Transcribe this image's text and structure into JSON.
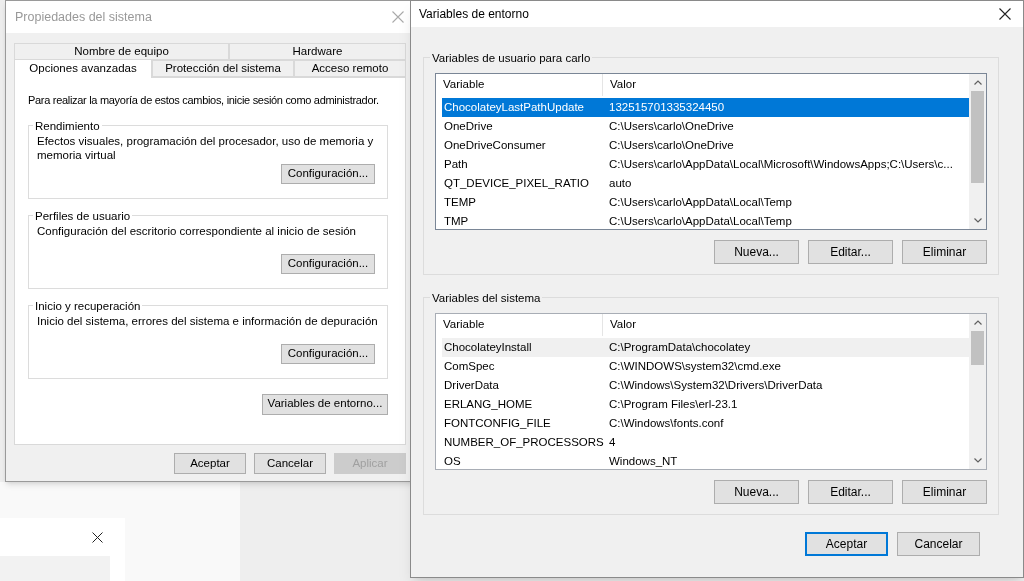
{
  "system_properties": {
    "title": "Propiedades del sistema",
    "tab_rows": [
      [
        {
          "label": "Nombre de equipo",
          "selected": false
        },
        {
          "label": "Hardware",
          "selected": false
        }
      ],
      [
        {
          "label": "Opciones avanzadas",
          "selected": true
        },
        {
          "label": "Protección del sistema",
          "selected": false
        },
        {
          "label": "Acceso remoto",
          "selected": false
        }
      ]
    ],
    "notice": "Para realizar la mayoría de estos cambios, inicie sesión como administrador.",
    "groups": [
      {
        "title": "Rendimiento",
        "description": "Efectos visuales, programación del procesador, uso de memoria y memoria virtual",
        "button": "Configuración..."
      },
      {
        "title": "Perfiles de usuario",
        "description": "Configuración del escritorio correspondiente al inicio de sesión",
        "button": "Configuración..."
      },
      {
        "title": "Inicio y recuperación",
        "description": "Inicio del sistema, errores del sistema e información de depuración",
        "button": "Configuración..."
      }
    ],
    "environment_button": "Variables de entorno...",
    "buttons": [
      {
        "label": "Aceptar",
        "disabled": false
      },
      {
        "label": "Cancelar",
        "disabled": false
      },
      {
        "label": "Aplicar",
        "disabled": true
      }
    ]
  },
  "environment_variables": {
    "title": "Variables de entorno",
    "sections": [
      {
        "title": "Variables de usuario para carlo",
        "focused": true,
        "columns": [
          "Variable",
          "Valor"
        ],
        "rows": [
          {
            "variable": "ChocolateyLastPathUpdate",
            "value": "132515701335324450",
            "selected": true
          },
          {
            "variable": "OneDrive",
            "value": "C:\\Users\\carlo\\OneDrive",
            "selected": false
          },
          {
            "variable": "OneDriveConsumer",
            "value": "C:\\Users\\carlo\\OneDrive",
            "selected": false
          },
          {
            "variable": "Path",
            "value": "C:\\Users\\carlo\\AppData\\Local\\Microsoft\\WindowsApps;C:\\Users\\c...",
            "selected": false
          },
          {
            "variable": "QT_DEVICE_PIXEL_RATIO",
            "value": "auto",
            "selected": false
          },
          {
            "variable": "TEMP",
            "value": "C:\\Users\\carlo\\AppData\\Local\\Temp",
            "selected": false
          },
          {
            "variable": "TMP",
            "value": "C:\\Users\\carlo\\AppData\\Local\\Temp",
            "selected": false
          }
        ],
        "buttons": [
          "Nueva...",
          "Editar...",
          "Eliminar"
        ]
      },
      {
        "title": "Variables del sistema",
        "focused": false,
        "columns": [
          "Variable",
          "Valor"
        ],
        "rows": [
          {
            "variable": "ChocolateyInstall",
            "value": "C:\\ProgramData\\chocolatey",
            "selected": true
          },
          {
            "variable": "ComSpec",
            "value": "C:\\WINDOWS\\system32\\cmd.exe",
            "selected": false
          },
          {
            "variable": "DriverData",
            "value": "C:\\Windows\\System32\\Drivers\\DriverData",
            "selected": false
          },
          {
            "variable": "ERLANG_HOME",
            "value": "C:\\Program Files\\erl-23.1",
            "selected": false
          },
          {
            "variable": "FONTCONFIG_FILE",
            "value": "C:\\Windows\\fonts.conf",
            "selected": false
          },
          {
            "variable": "NUMBER_OF_PROCESSORS",
            "value": "4",
            "selected": false
          },
          {
            "variable": "OS",
            "value": "Windows_NT",
            "selected": false
          }
        ],
        "buttons": [
          "Nueva...",
          "Editar...",
          "Eliminar"
        ]
      }
    ],
    "buttons": [
      {
        "label": "Aceptar",
        "default": true
      },
      {
        "label": "Cancelar",
        "default": false
      }
    ]
  }
}
